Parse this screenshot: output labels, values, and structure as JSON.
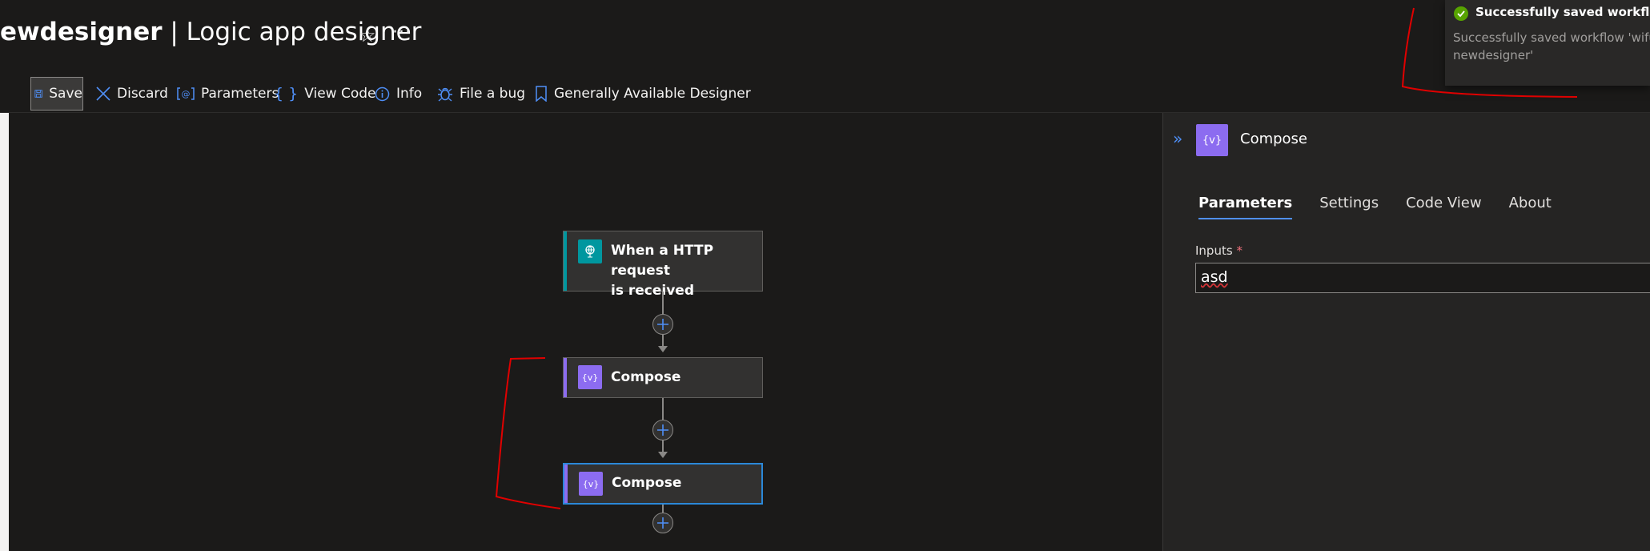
{
  "header": {
    "title_bold": "ewdesigner",
    "title_rest": " | Logic app designer",
    "star_icon": "star-icon",
    "more_icon": "more-icon"
  },
  "toolbar": {
    "save_label": "Save",
    "discard_label": "Discard",
    "parameters_label": "Parameters",
    "view_code_label": "View Code",
    "info_label": "Info",
    "file_bug_label": "File a bug",
    "ga_designer_label": "Generally Available Designer"
  },
  "workflow": {
    "trigger_label_line1": "When a HTTP request",
    "trigger_label_line2": "is received",
    "action1_label": "Compose",
    "action2_label": "Compose"
  },
  "panel": {
    "title": "Compose",
    "tabs": [
      "Parameters",
      "Settings",
      "Code View",
      "About"
    ],
    "active_tab": "Parameters",
    "inputs_label": "Inputs",
    "required_mark": "*",
    "inputs_value": "asd"
  },
  "toast": {
    "title": "Successfully saved workflow",
    "body": "Successfully saved workflow 'wifun\nnewdesigner'"
  },
  "colors": {
    "accent": "#4f8ff7",
    "compose": "#8c6cf0",
    "http_trigger": "#00979f",
    "success": "#57a300",
    "annotation": "#e00000"
  }
}
